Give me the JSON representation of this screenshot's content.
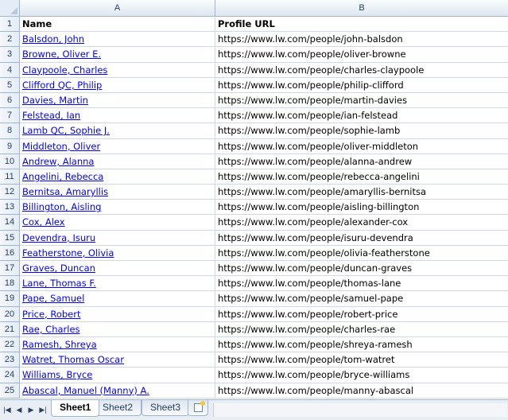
{
  "columns": {
    "a": "A",
    "b": "B"
  },
  "header_row": {
    "num": "1",
    "name": "Name",
    "url": "Profile URL"
  },
  "rows": [
    {
      "num": "2",
      "name": "Balsdon, John",
      "url": "https://www.lw.com/people/john-balsdon"
    },
    {
      "num": "3",
      "name": "Browne, Oliver E.",
      "url": "https://www.lw.com/people/oliver-browne"
    },
    {
      "num": "4",
      "name": "Claypoole, Charles",
      "url": "https://www.lw.com/people/charles-claypoole"
    },
    {
      "num": "5",
      "name": "Clifford QC, Philip",
      "url": "https://www.lw.com/people/philip-clifford"
    },
    {
      "num": "6",
      "name": "Davies, Martin",
      "url": "https://www.lw.com/people/martin-davies"
    },
    {
      "num": "7",
      "name": "Felstead, Ian",
      "url": "https://www.lw.com/people/ian-felstead"
    },
    {
      "num": "8",
      "name": "Lamb QC, Sophie J.",
      "url": "https://www.lw.com/people/sophie-lamb"
    },
    {
      "num": "9",
      "name": "Middleton, Oliver",
      "url": "https://www.lw.com/people/oliver-middleton"
    },
    {
      "num": "10",
      "name": "Andrew, Alanna",
      "url": "https://www.lw.com/people/alanna-andrew"
    },
    {
      "num": "11",
      "name": "Angelini, Rebecca",
      "url": "https://www.lw.com/people/rebecca-angelini"
    },
    {
      "num": "12",
      "name": "Bernitsa, Amaryllis",
      "url": "https://www.lw.com/people/amaryllis-bernitsa"
    },
    {
      "num": "13",
      "name": "Billington, Aisling",
      "url": "https://www.lw.com/people/aisling-billington"
    },
    {
      "num": "14",
      "name": "Cox, Alex",
      "url": "https://www.lw.com/people/alexander-cox"
    },
    {
      "num": "15",
      "name": "Devendra, Isuru",
      "url": "https://www.lw.com/people/isuru-devendra"
    },
    {
      "num": "16",
      "name": "Featherstone, Olivia",
      "url": "https://www.lw.com/people/olivia-featherstone"
    },
    {
      "num": "17",
      "name": "Graves, Duncan",
      "url": "https://www.lw.com/people/duncan-graves"
    },
    {
      "num": "18",
      "name": "Lane, Thomas F.",
      "url": "https://www.lw.com/people/thomas-lane"
    },
    {
      "num": "19",
      "name": "Pape, Samuel",
      "url": "https://www.lw.com/people/samuel-pape"
    },
    {
      "num": "20",
      "name": "Price, Robert",
      "url": "https://www.lw.com/people/robert-price"
    },
    {
      "num": "21",
      "name": "Rae, Charles",
      "url": "https://www.lw.com/people/charles-rae"
    },
    {
      "num": "22",
      "name": "Ramesh, Shreya",
      "url": "https://www.lw.com/people/shreya-ramesh"
    },
    {
      "num": "23",
      "name": "Watret, Thomas Oscar",
      "url": "https://www.lw.com/people/tom-watret"
    },
    {
      "num": "24",
      "name": "Williams, Bryce",
      "url": "https://www.lw.com/people/bryce-williams"
    },
    {
      "num": "25",
      "name": "Abascal, Manuel (Manny) A.",
      "url": "https://www.lw.com/people/manny-abascal"
    }
  ],
  "sheet_tabs": {
    "sheet1": "Sheet1",
    "sheet2": "Sheet2",
    "sheet3": "Sheet3",
    "active": "Sheet1"
  },
  "colors": {
    "link": "#0000ff",
    "header_bg": "#e4ecf7",
    "gridline": "#d0d7e5"
  }
}
